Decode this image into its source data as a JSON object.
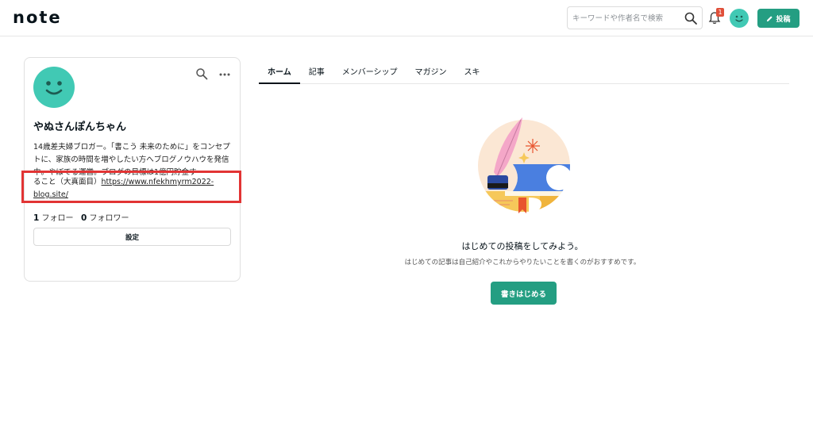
{
  "header": {
    "logo": "note",
    "search_placeholder": "キーワードや作者名で検索",
    "notification_count": "1",
    "post_label": "投稿"
  },
  "profile": {
    "name": "やぬさんぽんちゃん",
    "bio": "14歳差夫婦ブロガー。「書こう 未来のために」をコンセプトに、家族の時間を増やしたい方へブログノウハウを発信中。やぼてる運営。ブログの目標は1億円貯金す",
    "bio_tail": "ること（大真面目）",
    "link": "https://www.nfekhmyrm2022-blog.site/",
    "following_count": "1",
    "following_label": "フォロー",
    "followers_count": "0",
    "followers_label": "フォロワー",
    "settings_label": "設定"
  },
  "tabs": [
    {
      "label": "ホーム",
      "active": true
    },
    {
      "label": "記事"
    },
    {
      "label": "メンバーシップ"
    },
    {
      "label": "マガジン"
    },
    {
      "label": "スキ"
    }
  ],
  "empty_state": {
    "title": "はじめての投稿をしてみよう。",
    "subtitle": "はじめての記事は自己紹介やこれからやりたいことを書くのがおすすめです。",
    "button": "書きはじめる"
  },
  "colors": {
    "accent": "#249e82",
    "avatar": "#41c9b4",
    "badge": "#e0503a",
    "highlight": "#e23434"
  },
  "icons": [
    "search-icon",
    "bell-icon",
    "pencil-icon",
    "more-icon",
    "smile-avatar-icon"
  ]
}
